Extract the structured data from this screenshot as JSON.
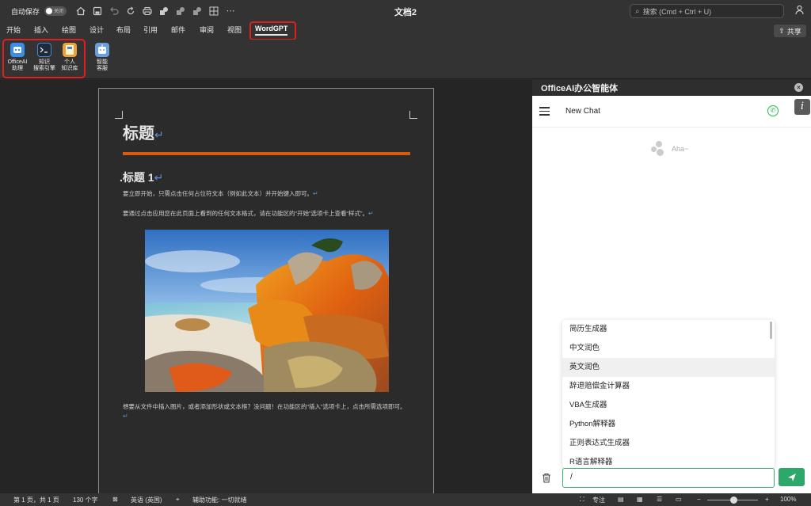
{
  "titlebar": {
    "autosave_label": "自动保存",
    "autosave_state": "关闭",
    "doc_title": "文档2",
    "search_placeholder": "搜索 (Cmd + Ctrl + U)"
  },
  "tabs": [
    {
      "label": "开始"
    },
    {
      "label": "插入"
    },
    {
      "label": "绘图"
    },
    {
      "label": "设计"
    },
    {
      "label": "布局"
    },
    {
      "label": "引用"
    },
    {
      "label": "邮件"
    },
    {
      "label": "审阅"
    },
    {
      "label": "视图"
    },
    {
      "label": "WordGPT"
    }
  ],
  "share_label": "共享",
  "ribbon": {
    "buttons": [
      {
        "line1": "OfficeAI",
        "line2": "助理",
        "color": "#3a8ee6"
      },
      {
        "line1": "知识",
        "line2": "搜索引擎",
        "color": "#4f86c6"
      },
      {
        "line1": "个人",
        "line2": "知识库",
        "color": "#e8a33a"
      },
      {
        "line1": "智能",
        "line2": "客服",
        "color": "#6aa0d8"
      }
    ]
  },
  "document": {
    "title": "标题",
    "heading1": ".标题 1",
    "para1": "要立即开始，只需点击任何占位符文本（例如此文本）并开始键入即可。",
    "para2": "要通过点击应用您在此页面上看到的任何文本格式，请在功能区的“开始”选项卡上查看“样式”。",
    "para3": "想要从文件中插入图片，或者添加形状或文本框？没问题！在功能区的“插入”选项卡上，点击所需选项即可。",
    "para_mark": "↵"
  },
  "panel": {
    "title": "OfficeAI办公智能体",
    "chat_title": "New Chat",
    "placeholder_text": "Aha~",
    "input_value": "/",
    "menu_items": [
      "简历生成器",
      "中文润色",
      "英文润色",
      "辞退赔偿金计算器",
      "VBA生成器",
      "Python解释器",
      "正则表达式生成器",
      "R语言解释器"
    ],
    "highlighted_index": 2
  },
  "status": {
    "page": "第 1 页，共 1 页",
    "words": "130 个字",
    "language": "英语 (英国)",
    "accessibility": "辅助功能: 一切就绪",
    "focus": "专注",
    "zoom": "100%"
  }
}
